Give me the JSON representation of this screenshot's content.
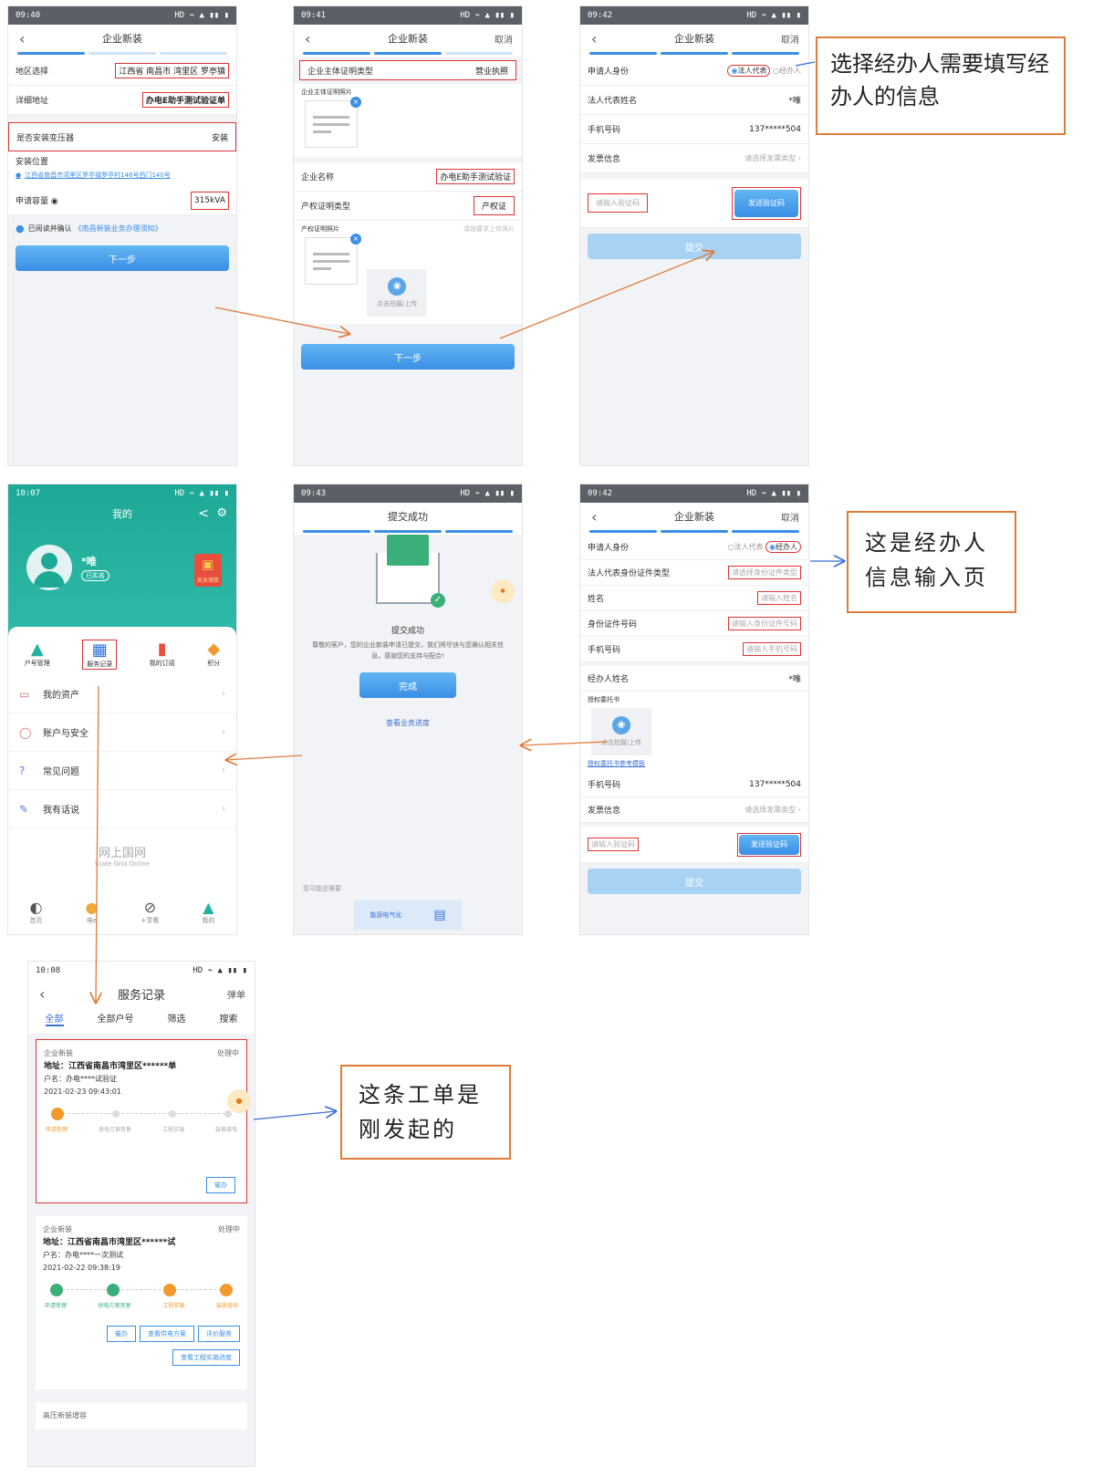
{
  "phone1": {
    "status_time": "09:40",
    "status_icons": "HD ⌁ ▲ ▮▮ ▮",
    "title": "企业新装",
    "rows": [
      {
        "label": "地区选择",
        "value": "江西省 南昌市 湾里区 罗亭镇"
      },
      {
        "label": "详细地址",
        "value": "办电E助手测试验证单"
      },
      {
        "label": "是否安装变压器",
        "value": "安装"
      },
      {
        "label": "安装位置",
        "value": ""
      },
      {
        "label": "申请容量",
        "value": "315kVA"
      }
    ],
    "location_text": "江西省南昌市湾里区罗亭镇罗亭村146号西门140号",
    "agree_text": "已阅读并确认",
    "agree_link": "《南昌新装业务办理须知》",
    "next_label": "下一步"
  },
  "phone2": {
    "status_time": "09:41",
    "status_icons": "HD ⌁ ▲ ▮▮ ▮",
    "title": "企业新装",
    "cancel": "取消",
    "row_type_label": "企业主体证明类型",
    "row_type_value": "营业执照",
    "photo_label": "企业主体证明照片",
    "company_label": "企业名称",
    "company_value": "办电E助手测试验证",
    "prop_label": "产权证明类型",
    "prop_value": "产权证",
    "prop_photo_label": "产权证明照片",
    "prop_photo_hint": "请按要求上传照片",
    "upload_label": "点击拍摄/上传",
    "next_label": "下一步"
  },
  "phone3": {
    "status_time": "09:42",
    "status_icons": "HD ⌁ ▲ ▮▮ ▮",
    "title": "企业新装",
    "cancel": "取消",
    "identity_label": "申请人身份",
    "opt_legal": "法人代表",
    "opt_agent": "经办人",
    "legal_name_label": "法人代表姓名",
    "legal_name_value": "*唯",
    "phone_label": "手机号码",
    "phone_value": "137*****504",
    "invoice_label": "发票信息",
    "invoice_value": "请选择发票类型",
    "code_placeholder": "请输入验证码",
    "send_code": "发送验证码",
    "submit": "提交"
  },
  "annotation1": "选择经办人需要填写经办人的信息",
  "phone4": {
    "status_time": "10:07",
    "status_icons": "HD ⌁ ▲ ▮▮ ▮",
    "title": "我的",
    "user_name": "*唯",
    "user_badge": "已实名",
    "gift_label": "天天领奖",
    "quick": [
      "户号管理",
      "服务记录",
      "我的订阅",
      "积分"
    ],
    "menu": [
      "我的资产",
      "账户与安全",
      "常见问题",
      "我有话说"
    ],
    "brand": "网上国网",
    "brand_sub": "State Grid Online",
    "tabs": [
      "首页",
      "电e",
      "+享看",
      "我的"
    ]
  },
  "phone5": {
    "status_time": "09:43",
    "status_icons": "HD ⌁ ▲ ▮▮ ▮",
    "title": "提交成功",
    "success_title": "提交成功",
    "success_desc": "尊敬的客户，您的企业新装申请已提交，我们将尽快与您确认相关信息，感谢您的支持与配合!",
    "done": "完成",
    "view_link": "查看业务进度",
    "maybe_label": "您可能还需要",
    "promo": "能源电气化"
  },
  "phone6": {
    "status_time": "09:42",
    "status_icons": "HD ⌁ ▲ ▮▮ ▮",
    "title": "企业新装",
    "cancel": "取消",
    "identity_label": "申请人身份",
    "opt_legal": "法人代表",
    "opt_agent": "经办人",
    "id_type_label": "法人代表身份证件类型",
    "id_type_ph": "请选择身份证件类型",
    "name_label": "姓名",
    "name_ph": "请输入姓名",
    "id_no_label": "身份证件号码",
    "id_no_ph": "请输入身份证件号码",
    "mobile_label": "手机号码",
    "mobile_ph": "请输入手机号码",
    "agent_name_label": "经办人姓名",
    "agent_name_value": "*唯",
    "auth_label": "授权委托书",
    "upload_label": "点击拍摄/上传",
    "auth_link": "授权委托书参考模板",
    "phone_label": "手机号码",
    "phone_value": "137*****504",
    "invoice_label": "发票信息",
    "invoice_value": "请选择发票类型",
    "code_placeholder": "请输入验证码",
    "send_code": "发送验证码",
    "submit": "提交"
  },
  "annotation2": "这是经办人信息输入页",
  "phone7": {
    "status_time": "10:08",
    "status_icons": "HD ⌁ ▲ ▮▮ ▮",
    "title": "服务记录",
    "right": "弹单",
    "tabs": [
      "全部",
      "全部户号",
      "筛选",
      "搜索"
    ],
    "card1": {
      "type": "企业新装",
      "state": "处理中",
      "addr": "地址：江西省南昌市湾里区******单",
      "owner": "户名：办电****试验证",
      "time": "2021-02-23 09:43:01",
      "steps": [
        "申请受理",
        "供电方案答复",
        "工程实施",
        "装表接电"
      ],
      "btn": "催办"
    },
    "card2": {
      "type": "企业新装",
      "state": "处理中",
      "addr": "地址：江西省南昌市湾里区******试",
      "owner": "户名：办电****一次测试",
      "time": "2021-02-22 09:38:19",
      "steps": [
        "申请受理",
        "供电方案答复",
        "工程实施",
        "装表接电"
      ],
      "btns": [
        "催办",
        "查看供电方案",
        "评价服务",
        "查看工程实施进度"
      ]
    },
    "card3_type": "高压新装增容"
  },
  "annotation3": "这条工单是刚发起的",
  "colors": {
    "accent": "#3a8ee6",
    "teal": "#21b3a0",
    "arrow": "#e07b39",
    "blue_arrow": "#3a6fd8",
    "box": "#d33"
  }
}
